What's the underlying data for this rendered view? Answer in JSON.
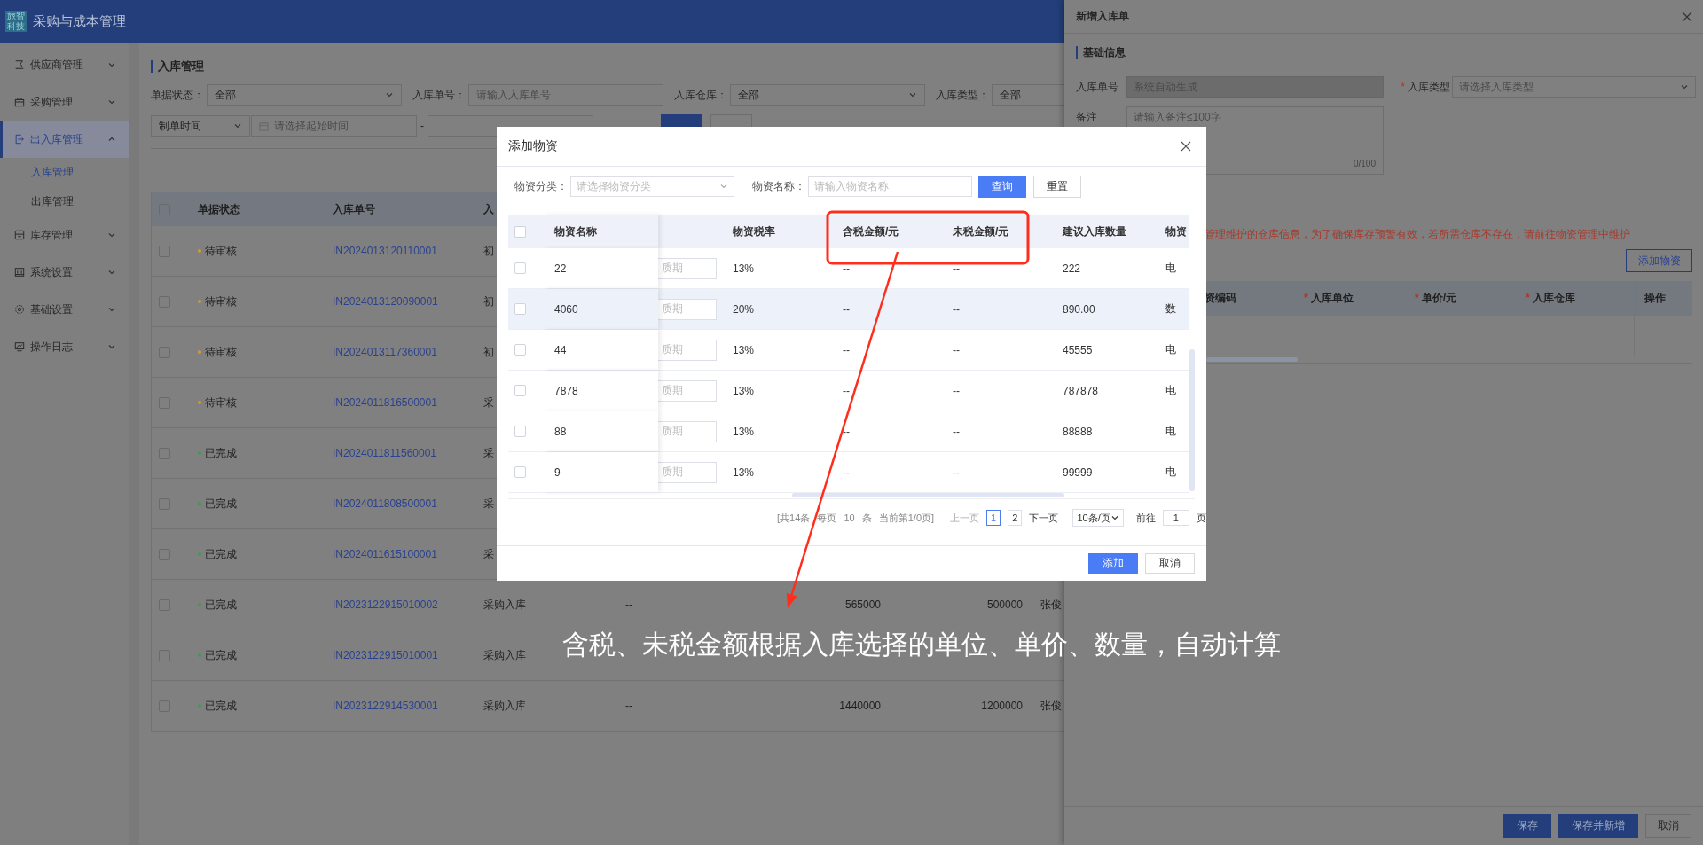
{
  "app": {
    "logo": "旅智科技",
    "title": "采购与成本管理"
  },
  "sidebar": {
    "items": [
      {
        "label": "供应商管理",
        "expanded": false
      },
      {
        "label": "采购管理",
        "expanded": false
      },
      {
        "label": "出入库管理",
        "expanded": true,
        "children": [
          {
            "label": "入库管理",
            "selected": true
          },
          {
            "label": "出库管理",
            "selected": false
          }
        ]
      },
      {
        "label": "库存管理",
        "expanded": false
      },
      {
        "label": "系统设置",
        "expanded": false
      },
      {
        "label": "基础设置",
        "expanded": false
      },
      {
        "label": "操作日志",
        "expanded": false
      }
    ]
  },
  "page": {
    "title": "入库管理",
    "filters": [
      {
        "label": "单据状态：",
        "kind": "select",
        "value": "全部"
      },
      {
        "label": "入库单号：",
        "kind": "input",
        "placeholder": "请输入入库单号"
      },
      {
        "label": "入库仓库：",
        "kind": "select",
        "value": "全部"
      },
      {
        "label": "入库类型：",
        "kind": "select",
        "value": "全部"
      }
    ],
    "date_filter": {
      "type": "制单时间",
      "start_placeholder": "请选择起始时间",
      "separator": "-"
    },
    "table": {
      "all_checked": false,
      "columns": [
        "单据状态",
        "入库单号",
        "入"
      ],
      "rows": [
        {
          "checked": false,
          "status": "待审核",
          "color": "#d39a2a",
          "number": "IN2024013120110001",
          "type": "初"
        },
        {
          "checked": false,
          "status": "待审核",
          "color": "#d39a2a",
          "number": "IN2024013120090001",
          "type": "初"
        },
        {
          "checked": false,
          "status": "待审核",
          "color": "#d39a2a",
          "number": "IN2024013117360001",
          "type": "初"
        },
        {
          "checked": false,
          "status": "待审核",
          "color": "#d39a2a",
          "number": "IN2024011816500001",
          "type": "采"
        },
        {
          "checked": false,
          "status": "已完成",
          "color": "#3f9a52",
          "number": "IN2024011811560001",
          "type": "采"
        },
        {
          "checked": false,
          "status": "已完成",
          "color": "#3f9a52",
          "number": "IN2024011808500001",
          "type": "采"
        },
        {
          "checked": false,
          "status": "已完成",
          "color": "#3f9a52",
          "number": "IN2024011615100001",
          "type": "采"
        },
        {
          "checked": false,
          "status": "已完成",
          "color": "#3f9a52",
          "number": "IN2023122915010002",
          "type": "采购入库",
          "column_4": "--",
          "column_5": "565000",
          "column_6": "500000",
          "column_7": "张俊"
        },
        {
          "checked": false,
          "status": "已完成",
          "color": "#3f9a52",
          "number": "IN2023122915010001",
          "type": "采购入库"
        },
        {
          "checked": false,
          "status": "已完成",
          "color": "#3f9a52",
          "number": "IN2023122914530001",
          "type": "采购入库",
          "column_4": "--",
          "column_5": "1440000",
          "column_6": "1200000",
          "column_7": "张俊"
        }
      ]
    }
  },
  "drawer": {
    "title": "新增入库单",
    "section": "基础信息",
    "fields": [
      {
        "label": "入库单号",
        "kind": "input",
        "placeholder": "系统自动生成",
        "disabled": true
      },
      {
        "label": "入库类型",
        "required_mark": "*",
        "kind": "select",
        "placeholder": "请选择入库类型",
        "disabled": false
      }
    ],
    "remark": {
      "label": "备注",
      "placeholder": "请输入备注≤100字",
      "counter": "0/100"
    },
    "notice": "管理维护的仓库信息，为了确保库存预警有效，若所需仓库不存在，请前往物资管理中维护",
    "add_button": "添加物资",
    "table_columns": [
      {
        "label": "资编码"
      },
      {
        "label": "入库单位",
        "required_mark": "*"
      },
      {
        "label": "单价/元",
        "required_mark": "*"
      },
      {
        "label": "入库仓库",
        "required_mark": "*"
      },
      {
        "label": "操作"
      }
    ],
    "buttons": [
      {
        "label": "保存",
        "primary": true
      },
      {
        "label": "保存并新增",
        "primary": true
      },
      {
        "label": "取消",
        "primary": false
      }
    ]
  },
  "modal": {
    "title": "添加物资",
    "filters": [
      {
        "label": "物资分类：",
        "kind": "select",
        "placeholder": "请选择物资分类"
      },
      {
        "label": "物资名称：",
        "kind": "input",
        "placeholder": "请输入物资名称"
      }
    ],
    "buttons": [
      {
        "label": "查询",
        "primary": true
      },
      {
        "label": "重置",
        "primary": false
      }
    ],
    "table": {
      "all_checked": false,
      "columns": [
        "物资名称",
        "物资税率",
        "含税金额/元",
        "未税金额/元",
        "建议入库数量",
        "物资"
      ],
      "rows": [
        {
          "checked": false,
          "hovered": false,
          "name": "22",
          "shelf_life_placeholder": "质期",
          "tax_rate": "13%",
          "amount_incl_tax": "--",
          "amount_excl_tax": "--",
          "suggested_qty": "222",
          "column_7": "电"
        },
        {
          "checked": false,
          "hovered": true,
          "name": "4060",
          "shelf_life_placeholder": "质期",
          "tax_rate": "20%",
          "amount_incl_tax": "--",
          "amount_excl_tax": "--",
          "suggested_qty": "890.00",
          "column_7": "数"
        },
        {
          "checked": false,
          "hovered": false,
          "name": "44",
          "shelf_life_placeholder": "质期",
          "tax_rate": "13%",
          "amount_incl_tax": "--",
          "amount_excl_tax": "--",
          "suggested_qty": "45555",
          "column_7": "电"
        },
        {
          "checked": false,
          "hovered": false,
          "name": "7878",
          "shelf_life_placeholder": "质期",
          "tax_rate": "13%",
          "amount_incl_tax": "--",
          "amount_excl_tax": "--",
          "suggested_qty": "787878",
          "column_7": "电"
        },
        {
          "checked": false,
          "hovered": false,
          "name": "88",
          "shelf_life_placeholder": "质期",
          "tax_rate": "13%",
          "amount_incl_tax": "--",
          "amount_excl_tax": "--",
          "suggested_qty": "88888",
          "column_7": "电"
        },
        {
          "checked": false,
          "hovered": false,
          "name": "9",
          "shelf_life_placeholder": "质期",
          "tax_rate": "13%",
          "amount_incl_tax": "--",
          "amount_excl_tax": "--",
          "suggested_qty": "99999",
          "column_7": "电"
        }
      ]
    },
    "pagination": {
      "summary": "[共14条 每页 10 条 当前第1/0页]",
      "prev": "上一页",
      "pages": [
        {
          "label": "1",
          "selected": true
        },
        {
          "label": "2",
          "selected": false
        }
      ],
      "next": "下一页",
      "page_size": "10条/页",
      "goto_label": "前往",
      "goto_value": "1",
      "goto_suffix": "页"
    },
    "footer_buttons": [
      {
        "label": "添加",
        "primary": true
      },
      {
        "label": "取消",
        "primary": false
      }
    ]
  },
  "annotation": {
    "text": "含税、未税金额根据入库选择的单位、单价、数量，自动计算"
  }
}
